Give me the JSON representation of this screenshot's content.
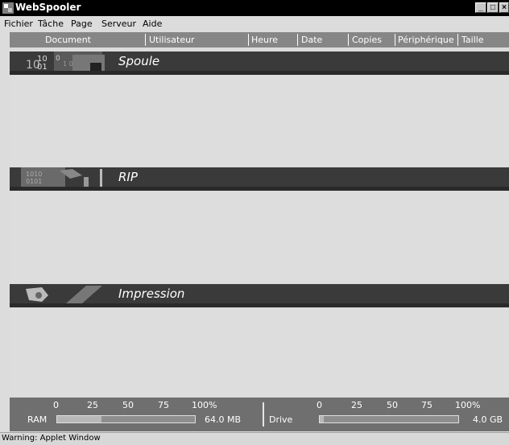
{
  "window": {
    "title": "WebSpooler",
    "buttons": {
      "minimize": "_",
      "maximize": "□",
      "close": "×"
    }
  },
  "menu": [
    {
      "label": "Fichier"
    },
    {
      "label": "Tâche"
    },
    {
      "label": "Page"
    },
    {
      "label": "Serveur"
    },
    {
      "label": "Aide"
    }
  ],
  "columns": [
    "Document",
    "Utilisateur",
    "Heure",
    "Date",
    "Copies",
    "Périphérique",
    "Taille"
  ],
  "sections": [
    {
      "label": "Spoule",
      "art": "binary-digits-art"
    },
    {
      "label": "RIP",
      "art": "binary-ribbon-art"
    },
    {
      "label": "Impression",
      "art": "printer-art"
    }
  ],
  "gauges": {
    "ram": {
      "label": "RAM",
      "ticks": [
        "0",
        "25",
        "50",
        "75",
        "100%"
      ],
      "value_text": "64.0 MB",
      "fill_fraction": 0.32
    },
    "drive": {
      "label": "Drive",
      "ticks": [
        "0",
        "25",
        "50",
        "75",
        "100%"
      ],
      "value_text": "4.0 GB",
      "fill_fraction": 0.03
    }
  },
  "status": "Warning: Applet Window"
}
